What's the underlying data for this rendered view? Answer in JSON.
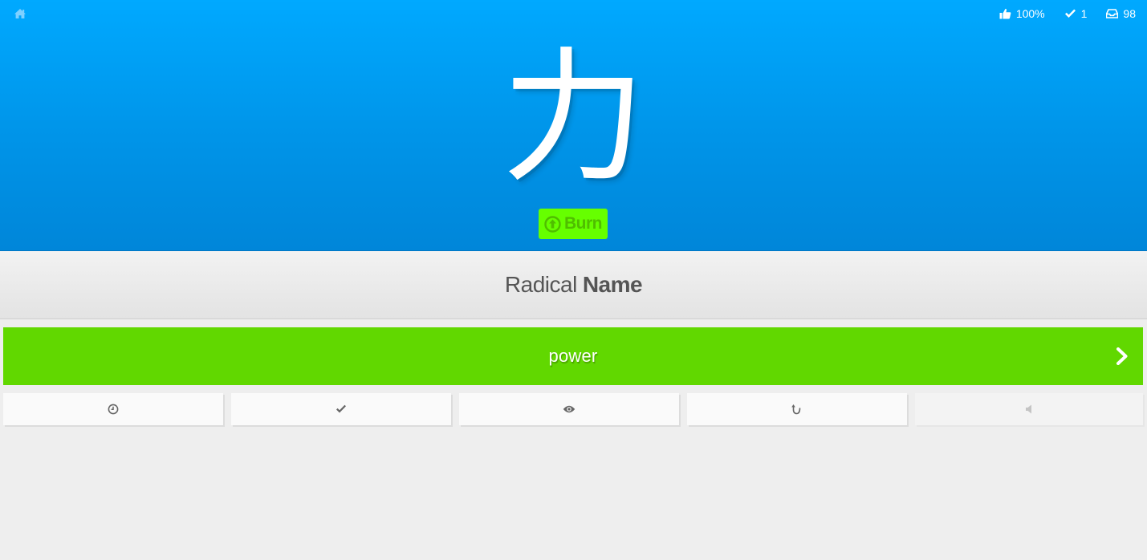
{
  "header": {
    "home_icon": "home-icon",
    "stats": [
      {
        "icon": "thumbs-up-icon",
        "value": "100%"
      },
      {
        "icon": "checkmark-icon",
        "value": "1"
      },
      {
        "icon": "inbox-icon",
        "value": "98"
      }
    ],
    "character": "力",
    "burn_label": "Burn",
    "burn_icon": "arrow-up-circle-icon"
  },
  "question": {
    "type": "Radical",
    "category": "Name"
  },
  "answer": {
    "value": "power",
    "submit_icon": "chevron-right-icon",
    "correct_color": "#61d800"
  },
  "additional_buttons": [
    {
      "icon": "clock-icon"
    },
    {
      "icon": "checkmark-icon"
    },
    {
      "icon": "eye-icon"
    },
    {
      "icon": "undo-icon"
    },
    {
      "icon": "audio-icon"
    }
  ],
  "colors": {
    "header_blue": "#00a1f1",
    "burn_green": "#66ff00",
    "answer_green": "#61d800"
  }
}
